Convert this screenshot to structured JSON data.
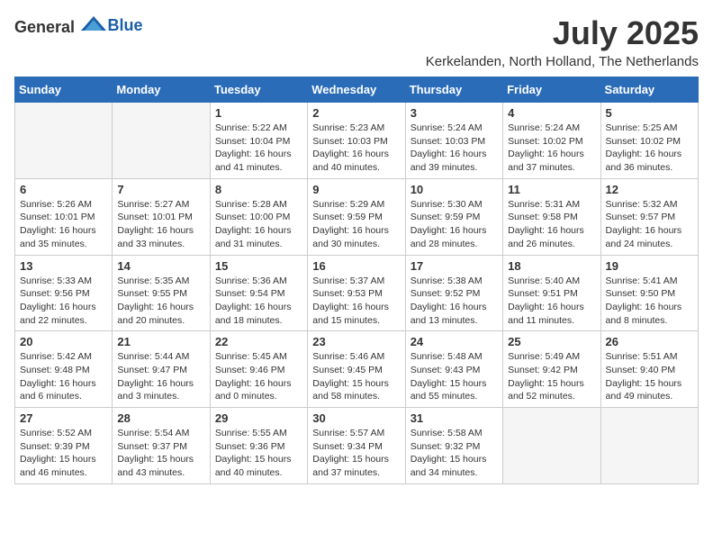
{
  "logo": {
    "general": "General",
    "blue": "Blue"
  },
  "title": "July 2025",
  "subtitle": "Kerkelanden, North Holland, The Netherlands",
  "days_header": [
    "Sunday",
    "Monday",
    "Tuesday",
    "Wednesday",
    "Thursday",
    "Friday",
    "Saturday"
  ],
  "weeks": [
    [
      {
        "day": "",
        "info": ""
      },
      {
        "day": "",
        "info": ""
      },
      {
        "day": "1",
        "info": "Sunrise: 5:22 AM\nSunset: 10:04 PM\nDaylight: 16 hours\nand 41 minutes."
      },
      {
        "day": "2",
        "info": "Sunrise: 5:23 AM\nSunset: 10:03 PM\nDaylight: 16 hours\nand 40 minutes."
      },
      {
        "day": "3",
        "info": "Sunrise: 5:24 AM\nSunset: 10:03 PM\nDaylight: 16 hours\nand 39 minutes."
      },
      {
        "day": "4",
        "info": "Sunrise: 5:24 AM\nSunset: 10:02 PM\nDaylight: 16 hours\nand 37 minutes."
      },
      {
        "day": "5",
        "info": "Sunrise: 5:25 AM\nSunset: 10:02 PM\nDaylight: 16 hours\nand 36 minutes."
      }
    ],
    [
      {
        "day": "6",
        "info": "Sunrise: 5:26 AM\nSunset: 10:01 PM\nDaylight: 16 hours\nand 35 minutes."
      },
      {
        "day": "7",
        "info": "Sunrise: 5:27 AM\nSunset: 10:01 PM\nDaylight: 16 hours\nand 33 minutes."
      },
      {
        "day": "8",
        "info": "Sunrise: 5:28 AM\nSunset: 10:00 PM\nDaylight: 16 hours\nand 31 minutes."
      },
      {
        "day": "9",
        "info": "Sunrise: 5:29 AM\nSunset: 9:59 PM\nDaylight: 16 hours\nand 30 minutes."
      },
      {
        "day": "10",
        "info": "Sunrise: 5:30 AM\nSunset: 9:59 PM\nDaylight: 16 hours\nand 28 minutes."
      },
      {
        "day": "11",
        "info": "Sunrise: 5:31 AM\nSunset: 9:58 PM\nDaylight: 16 hours\nand 26 minutes."
      },
      {
        "day": "12",
        "info": "Sunrise: 5:32 AM\nSunset: 9:57 PM\nDaylight: 16 hours\nand 24 minutes."
      }
    ],
    [
      {
        "day": "13",
        "info": "Sunrise: 5:33 AM\nSunset: 9:56 PM\nDaylight: 16 hours\nand 22 minutes."
      },
      {
        "day": "14",
        "info": "Sunrise: 5:35 AM\nSunset: 9:55 PM\nDaylight: 16 hours\nand 20 minutes."
      },
      {
        "day": "15",
        "info": "Sunrise: 5:36 AM\nSunset: 9:54 PM\nDaylight: 16 hours\nand 18 minutes."
      },
      {
        "day": "16",
        "info": "Sunrise: 5:37 AM\nSunset: 9:53 PM\nDaylight: 16 hours\nand 15 minutes."
      },
      {
        "day": "17",
        "info": "Sunrise: 5:38 AM\nSunset: 9:52 PM\nDaylight: 16 hours\nand 13 minutes."
      },
      {
        "day": "18",
        "info": "Sunrise: 5:40 AM\nSunset: 9:51 PM\nDaylight: 16 hours\nand 11 minutes."
      },
      {
        "day": "19",
        "info": "Sunrise: 5:41 AM\nSunset: 9:50 PM\nDaylight: 16 hours\nand 8 minutes."
      }
    ],
    [
      {
        "day": "20",
        "info": "Sunrise: 5:42 AM\nSunset: 9:48 PM\nDaylight: 16 hours\nand 6 minutes."
      },
      {
        "day": "21",
        "info": "Sunrise: 5:44 AM\nSunset: 9:47 PM\nDaylight: 16 hours\nand 3 minutes."
      },
      {
        "day": "22",
        "info": "Sunrise: 5:45 AM\nSunset: 9:46 PM\nDaylight: 16 hours\nand 0 minutes."
      },
      {
        "day": "23",
        "info": "Sunrise: 5:46 AM\nSunset: 9:45 PM\nDaylight: 15 hours\nand 58 minutes."
      },
      {
        "day": "24",
        "info": "Sunrise: 5:48 AM\nSunset: 9:43 PM\nDaylight: 15 hours\nand 55 minutes."
      },
      {
        "day": "25",
        "info": "Sunrise: 5:49 AM\nSunset: 9:42 PM\nDaylight: 15 hours\nand 52 minutes."
      },
      {
        "day": "26",
        "info": "Sunrise: 5:51 AM\nSunset: 9:40 PM\nDaylight: 15 hours\nand 49 minutes."
      }
    ],
    [
      {
        "day": "27",
        "info": "Sunrise: 5:52 AM\nSunset: 9:39 PM\nDaylight: 15 hours\nand 46 minutes."
      },
      {
        "day": "28",
        "info": "Sunrise: 5:54 AM\nSunset: 9:37 PM\nDaylight: 15 hours\nand 43 minutes."
      },
      {
        "day": "29",
        "info": "Sunrise: 5:55 AM\nSunset: 9:36 PM\nDaylight: 15 hours\nand 40 minutes."
      },
      {
        "day": "30",
        "info": "Sunrise: 5:57 AM\nSunset: 9:34 PM\nDaylight: 15 hours\nand 37 minutes."
      },
      {
        "day": "31",
        "info": "Sunrise: 5:58 AM\nSunset: 9:32 PM\nDaylight: 15 hours\nand 34 minutes."
      },
      {
        "day": "",
        "info": ""
      },
      {
        "day": "",
        "info": ""
      }
    ]
  ]
}
